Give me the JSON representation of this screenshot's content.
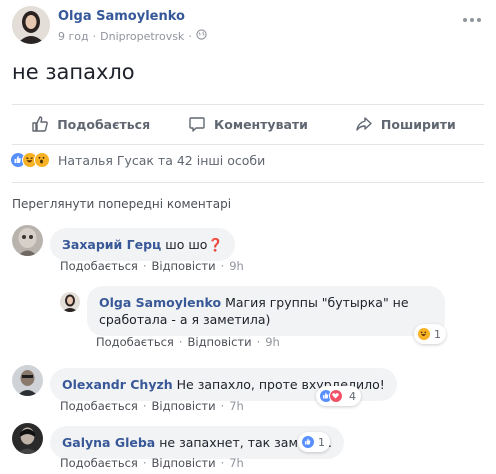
{
  "post": {
    "author": "Olga Samoylenko",
    "time": "9 год",
    "location": "Dnipropetrovsk",
    "text": "не запахло"
  },
  "actions": {
    "like": "Подобається",
    "comment": "Коментувати",
    "share": "Поширити"
  },
  "reactions": {
    "summary": "Наталья Гусак та 42 інші особи",
    "icons": [
      "like-icon",
      "haha-icon",
      "wow-icon"
    ]
  },
  "view_previous": "Переглянути попередні коментарі",
  "comments": [
    {
      "author": "Захарий Герц",
      "text": "шо шо❓",
      "like": "Подобається",
      "reply": "Відповісти",
      "time": "9h"
    },
    {
      "author": "Olga Samoylenko",
      "text": "Магия группы \"бутырка\" не сработала - а я заметила)",
      "like": "Подобається",
      "reply": "Відповісти",
      "time": "9h",
      "reaction_count": "1"
    },
    {
      "author": "Olexandr Chyzh",
      "text": "Не запахло, проте вхурделило!",
      "like": "Подобається",
      "reply": "Відповісти",
      "time": "7h",
      "reaction_count": "4"
    },
    {
      "author": "Galyna Gleba",
      "text": "не запахнет, так заметет.",
      "like": "Подобається",
      "reply": "Відповісти",
      "time": "7h",
      "reaction_count": "1"
    }
  ],
  "separator": "·",
  "colors": {
    "link": "#385898",
    "meta": "#90949c",
    "like": "#5890ff",
    "haha": "#f7b125",
    "love": "#f25268"
  }
}
